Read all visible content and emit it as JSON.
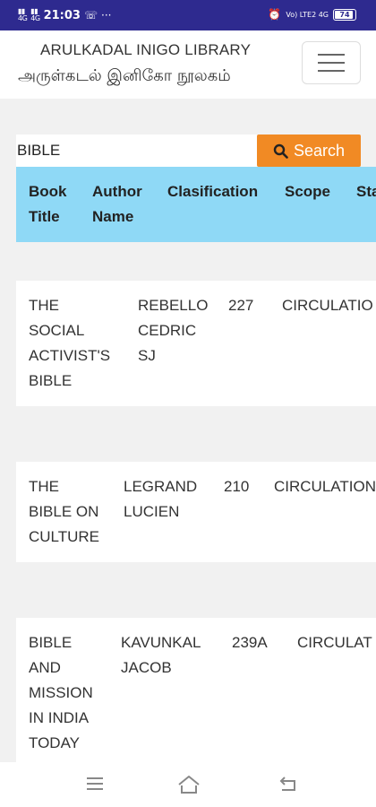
{
  "status_bar": {
    "signal1": "4G",
    "signal2": "4G",
    "time": "21:03",
    "extra": "···",
    "right_labels": "Vo) LTE2 4G",
    "battery": "74"
  },
  "header": {
    "title_en": "ARULKADAL INIGO LIBRARY",
    "title_ta": "அருள்கடல் இனிகோ நூலகம்"
  },
  "search": {
    "value": "BIBLE",
    "button_label": "Search"
  },
  "table": {
    "columns": [
      {
        "line1": "Book",
        "line2": "Title"
      },
      {
        "line1": "Author",
        "line2": "Name"
      },
      {
        "line1": "Clasification",
        "line2": ""
      },
      {
        "line1": "Scope",
        "line2": ""
      },
      {
        "line1": "Sta",
        "line2": ""
      }
    ],
    "rows": [
      {
        "title": [
          "THE",
          "SOCIAL",
          "ACTIVIST'S",
          "BIBLE"
        ],
        "author": [
          "REBELLO",
          "CEDRIC",
          "SJ"
        ],
        "classification": "227",
        "scope": "CIRCULATIO"
      },
      {
        "title": [
          "THE",
          "BIBLE ON",
          "CULTURE"
        ],
        "author": [
          "LEGRAND",
          "LUCIEN"
        ],
        "classification": "210",
        "scope": "CIRCULATION"
      },
      {
        "title": [
          "BIBLE",
          "AND",
          "MISSION",
          "IN INDIA",
          "TODAY"
        ],
        "author": [
          "KAVUNKAL",
          "JACOB"
        ],
        "classification": "239A",
        "scope": "CIRCULAT"
      }
    ]
  },
  "colors": {
    "status_bar": "#2e2a8f",
    "table_header": "#8fd9f6",
    "search_button": "#f18a24",
    "page_background": "#f1f1f1"
  },
  "icons": [
    "search-icon",
    "menu-icon",
    "nav-menu-icon",
    "nav-home-icon",
    "nav-back-icon"
  ]
}
